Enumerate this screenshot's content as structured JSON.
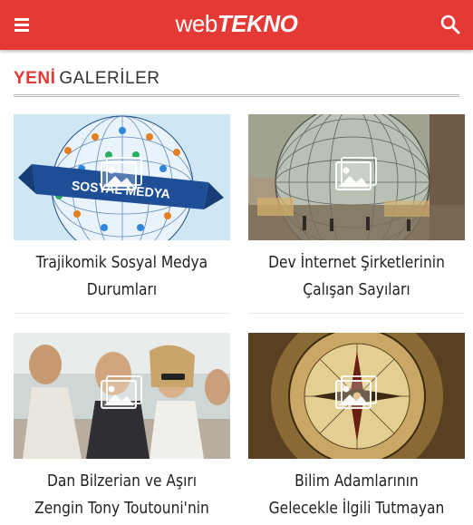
{
  "header": {
    "logo_part1": "web",
    "logo_part2": "TEKNO",
    "menu_icon": "hamburger-menu-icon",
    "search_icon": "search-icon",
    "brand_color": "#e53935"
  },
  "section": {
    "accent_label": "YENİ",
    "label": "GALERİLER"
  },
  "galleries": [
    {
      "title_line1": "Trajikomik Sosyal Medya",
      "title_line2": "Durumları"
    },
    {
      "title_line1": "Dev İnternet Şirketlerinin",
      "title_line2": "Çalışan Sayıları"
    },
    {
      "title_line1": "Dan Bilzerian ve Aşırı",
      "title_line2": "Zengin Tony Toutouni'nin"
    },
    {
      "title_line1": "Bilim Adamlarının",
      "title_line2": "Gelecekle İlgili Tutmayan"
    }
  ],
  "thumb_overlay_icon": "image-gallery-icon"
}
